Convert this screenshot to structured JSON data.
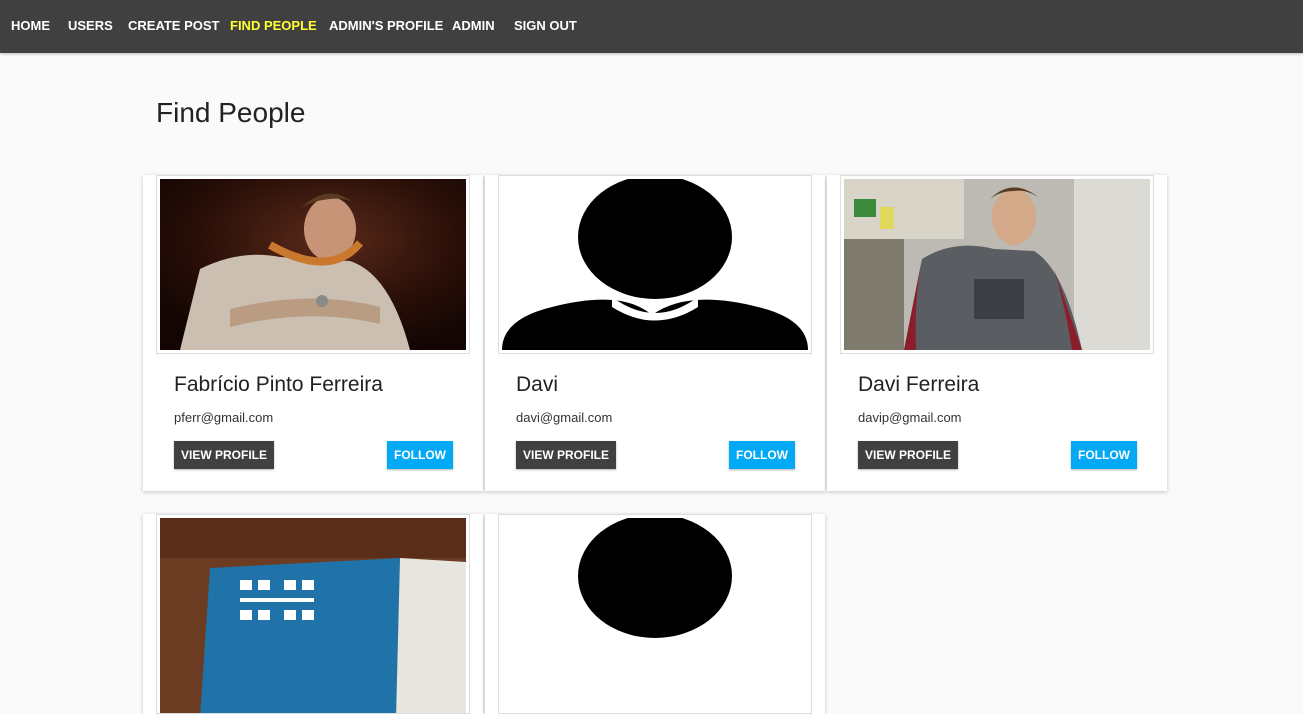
{
  "nav": {
    "items": [
      {
        "label": "HOME",
        "active": false
      },
      {
        "label": "USERS",
        "active": false
      },
      {
        "label": "CREATE POST",
        "active": false
      },
      {
        "label": "FIND PEOPLE",
        "active": true
      },
      {
        "label": "ADMIN'S PROFILE",
        "active": false
      },
      {
        "label": "ADMIN",
        "active": false
      },
      {
        "label": "SIGN OUT",
        "active": false
      }
    ],
    "active_color": "#ffff33"
  },
  "page": {
    "title": "Find People"
  },
  "people": [
    {
      "name": "Fabrício Pinto Ferreira",
      "email": "pferr@gmail.com",
      "photo": "user-photo",
      "view_label": "VIEW PROFILE",
      "follow_label": "FOLLOW"
    },
    {
      "name": "Davi",
      "email": "davi@gmail.com",
      "photo": "default-avatar",
      "view_label": "VIEW PROFILE",
      "follow_label": "FOLLOW"
    },
    {
      "name": "Davi Ferreira",
      "email": "davip@gmail.com",
      "photo": "user-photo",
      "view_label": "VIEW PROFILE",
      "follow_label": "FOLLOW"
    },
    {
      "photo": "user-photo"
    },
    {
      "photo": "default-avatar"
    }
  ],
  "colors": {
    "navbar": "#404040",
    "follow_button": "#03a9f4",
    "view_button": "#404040"
  }
}
